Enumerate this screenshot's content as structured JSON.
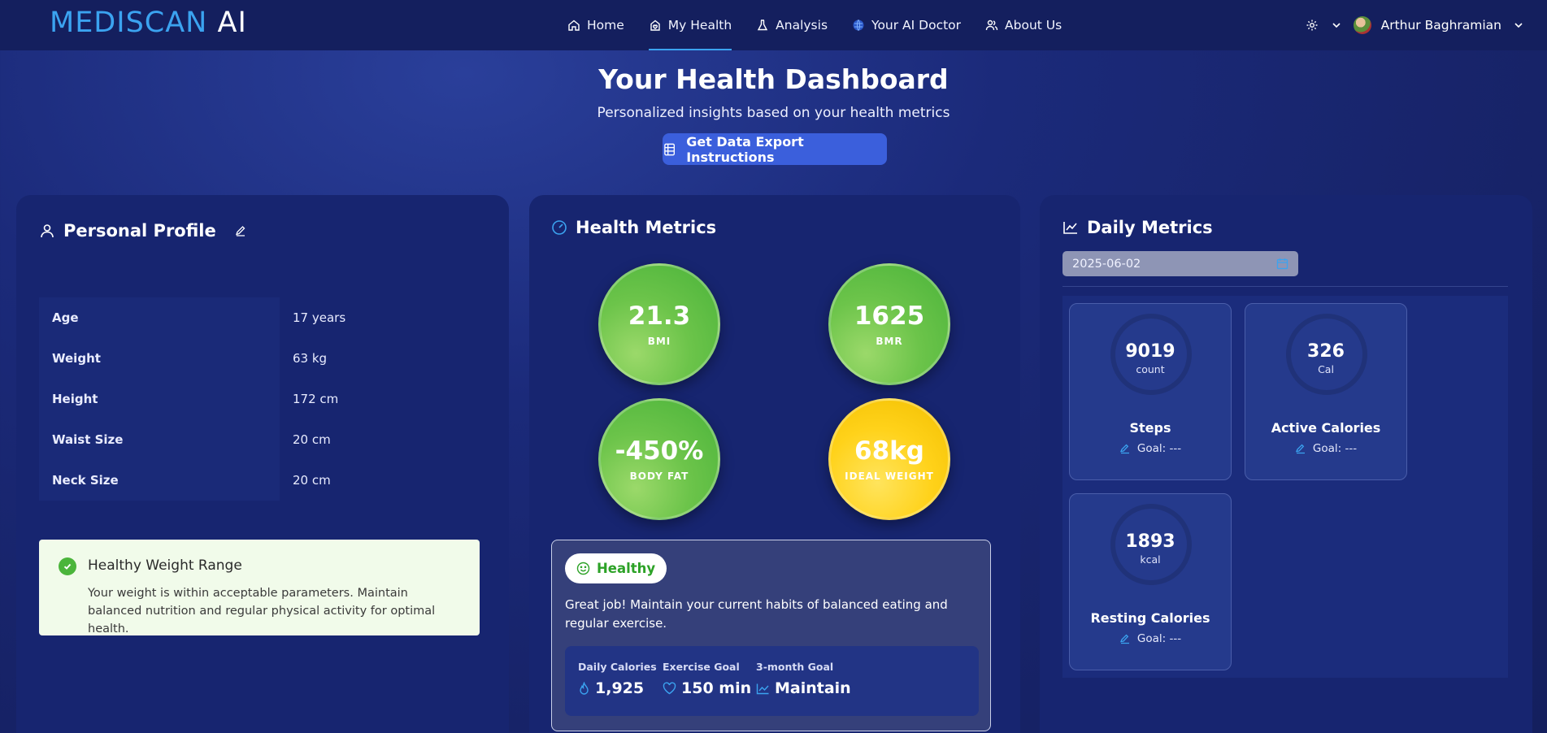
{
  "app": {
    "brand": "MEDISCAN",
    "brand_suffix": "AI"
  },
  "nav": {
    "items": [
      {
        "label": "Home",
        "icon": "home-icon"
      },
      {
        "label": "My Health",
        "icon": "heart-house-icon",
        "active": true
      },
      {
        "label": "Analysis",
        "icon": "flask-icon"
      },
      {
        "label": "Your AI Doctor",
        "icon": "globe-icon"
      },
      {
        "label": "About Us",
        "icon": "users-icon"
      }
    ],
    "user_name": "Arthur Baghramian"
  },
  "hero": {
    "title": "Your Health Dashboard",
    "subtitle": "Personalized insights based on your health metrics",
    "export_label": "Get Data Export Instructions"
  },
  "profile": {
    "title": "Personal Profile",
    "rows": [
      {
        "label": "Age",
        "value": "17 years"
      },
      {
        "label": "Weight",
        "value": "63 kg"
      },
      {
        "label": "Height",
        "value": "172 cm"
      },
      {
        "label": "Waist Size",
        "value": "20 cm"
      },
      {
        "label": "Neck Size",
        "value": "20 cm"
      }
    ],
    "alert_title": "Healthy Weight Range",
    "alert_text": "Your weight is within acceptable parameters. Maintain balanced nutrition and regular physical activity for optimal health."
  },
  "metrics": {
    "title": "Health Metrics",
    "items": [
      {
        "value": "21.3",
        "label": "BMI",
        "color": "#5cbf3f"
      },
      {
        "value": "1625",
        "label": "BMR",
        "color": "#5cbf3f"
      },
      {
        "value": "-450%",
        "label": "BODY FAT",
        "color": "#5cbf3f"
      },
      {
        "value": "68kg",
        "label": "IDEAL WEIGHT",
        "color": "#ffd21a"
      }
    ],
    "status": "Healthy",
    "status_text": "Great job! Maintain your current habits of balanced eating and regular exercise.",
    "goals": [
      {
        "label": "Daily Calories",
        "value": "1,925"
      },
      {
        "label": "Exercise Goal",
        "value": "150 min"
      },
      {
        "label": "3-month Goal",
        "value": "Maintain"
      }
    ]
  },
  "daily": {
    "title": "Daily Metrics",
    "date": "2025-06-02",
    "cards": [
      {
        "value": "9019",
        "unit": "count",
        "name": "Steps",
        "goal": "Goal: ---"
      },
      {
        "value": "326",
        "unit": "Cal",
        "name": "Active Calories",
        "goal": "Goal: ---"
      },
      {
        "value": "1893",
        "unit": "kcal",
        "name": "Resting Calories",
        "goal": "Goal: ---"
      }
    ]
  }
}
